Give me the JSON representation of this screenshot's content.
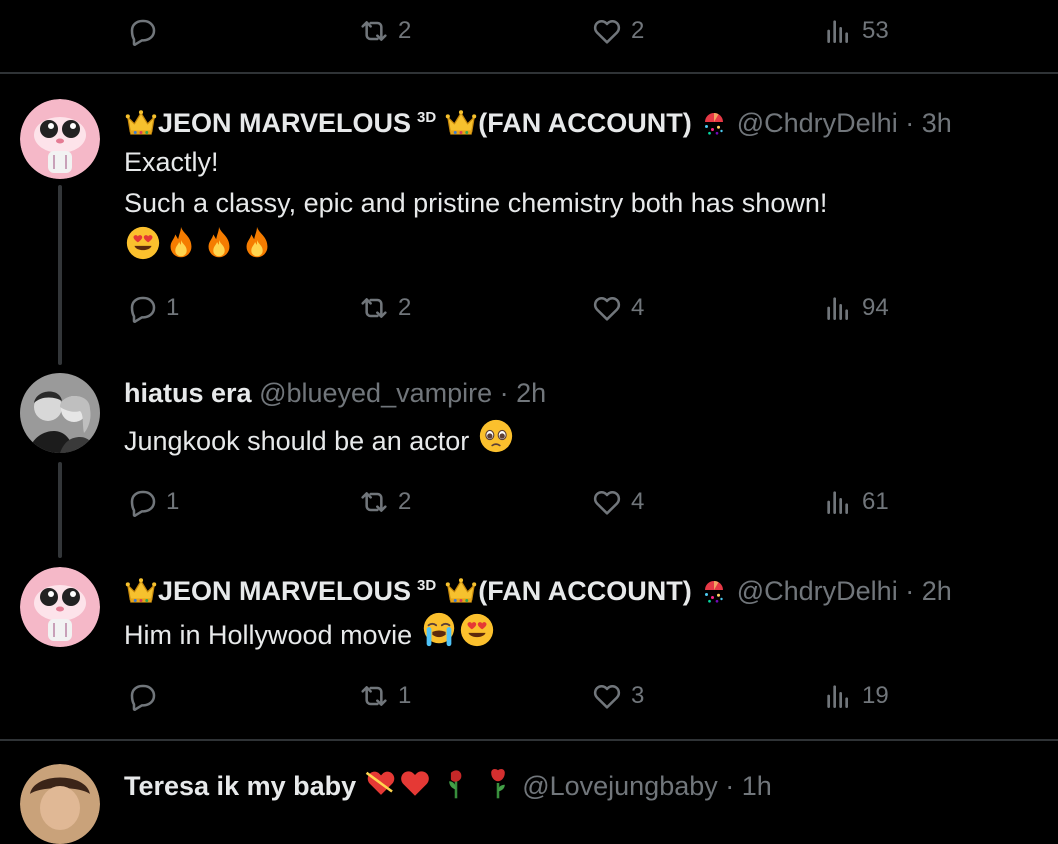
{
  "top_actions": {
    "reply": "",
    "retweet": "2",
    "like": "2",
    "views": "53"
  },
  "tweets": [
    {
      "name_pre": "JEON MARVELOUS",
      "sup": "3D",
      "name_post": "(FAN ACCOUNT)",
      "handle": "@ChdryDelhi",
      "time": "· 3h",
      "lines": [
        "Exactly!",
        "Such a classy, epic and pristine chemistry both has shown!"
      ],
      "emoji_line": [
        "heart-eyes",
        "fire",
        "fire",
        "fire"
      ],
      "actions": {
        "reply": "1",
        "retweet": "2",
        "like": "4",
        "views": "94"
      }
    },
    {
      "name": "hiatus era",
      "handle": "@blueyed_vampire",
      "time": "· 2h",
      "text": "Jungkook should be an actor",
      "actions": {
        "reply": "1",
        "retweet": "2",
        "like": "4",
        "views": "61"
      }
    },
    {
      "name_pre": "JEON MARVELOUS",
      "sup": "3D",
      "name_post": "(FAN ACCOUNT)",
      "handle": "@ChdryDelhi",
      "time": "· 2h",
      "text": "Him in Hollywood movie",
      "actions": {
        "reply": "",
        "retweet": "1",
        "like": "3",
        "views": "19"
      }
    },
    {
      "name": "Teresa ik my baby",
      "handle": "@Lovejungbaby",
      "time": "· 1h"
    }
  ],
  "colors": {
    "background": "#000000",
    "text": "#e7e9ea",
    "muted": "#71767b",
    "divider": "#2f3336"
  }
}
